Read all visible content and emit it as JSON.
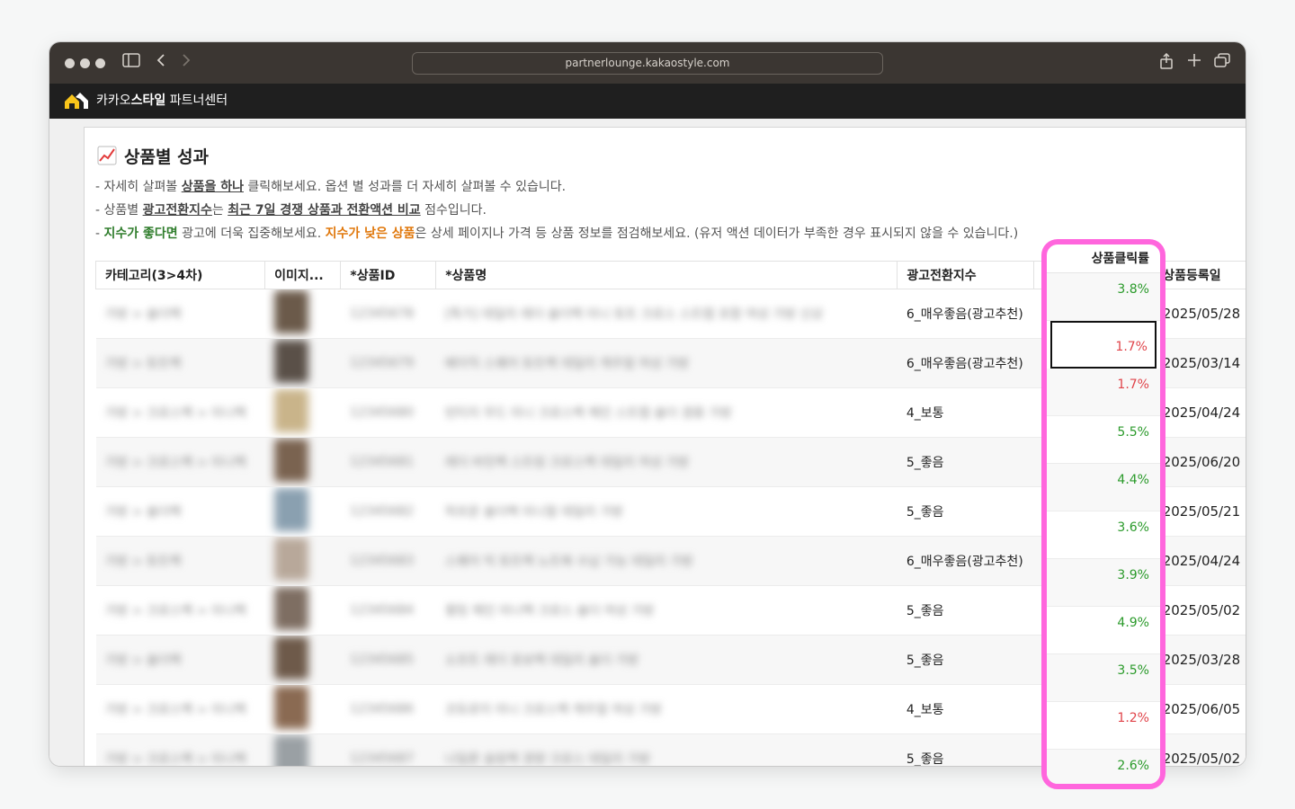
{
  "browser": {
    "url": "partnerlounge.kakaostyle.com",
    "icons": [
      "sidebar-icon",
      "back-icon",
      "forward-icon",
      "share-icon",
      "new-tab-icon",
      "tabs-icon"
    ]
  },
  "app": {
    "name_prefix": "카카오",
    "name_bold": "스타일",
    "name_suffix": " 파트너센터"
  },
  "section": {
    "title": "상품별 성과",
    "line1": {
      "a": "- 자세히 살펴볼 ",
      "b": "상품을 하나",
      "c": " 클릭해보세요. 옵션 별 성과를 더 자세히 살펴볼 수 있습니다."
    },
    "line2": {
      "a": "- 상품별 ",
      "b": "광고전환지수",
      "c": "는 ",
      "d": "최근 7일 경쟁 상품과 전환액션 비교",
      "e": " 점수입니다."
    },
    "line3": {
      "a": "- ",
      "b": "지수가 좋다면",
      "c": " 광고에 더욱 집중해보세요. ",
      "d": "지수가 낮은 상품",
      "e": "은 상세 페이지나 가격 등 상품 정보를 점검해보세요. (유저 액션 데이터가 부족한 경우 표시되지 않을 수 있습니다.)"
    }
  },
  "table": {
    "headers": {
      "category": "카테고리(3>4차)",
      "image": "이미지...",
      "id": "*상품ID",
      "name": "*상품명",
      "index": "광고전환지수",
      "click": "상품클릭률",
      "date": "상품등록일"
    },
    "rows": [
      {
        "category": "가방 > 숄더백",
        "id": "12345678",
        "name": "[특가] 데일리 레더 숄더백 미니 토트 크로스 스트랩 포함 여성 가방 신상",
        "index": "6_매우좋음(광고추천)",
        "tone": "green",
        "click": "3.8%",
        "click_tone": "green",
        "date": "2025/05/28"
      },
      {
        "category": "가방 > 토트백",
        "id": "12345679",
        "name": "베이직 스퀘어 토트백 데일리 캐주얼 여성 가방",
        "index": "6_매우좋음(광고추천)",
        "tone": "green",
        "click": "1.7%",
        "click_tone": "red",
        "date": "2025/03/14"
      },
      {
        "category": "가방 > 크로스백 > 미니백",
        "id": "12345680",
        "name": "빈티지 무드 미니 크로스백 체인 스트랩 숄더 겸용 가방",
        "index": "4_보통",
        "tone": "orange",
        "click": "1.7%",
        "click_tone": "red",
        "date": "2025/04/24"
      },
      {
        "category": "가방 > 크로스백 > 미니백",
        "id": "12345681",
        "name": "레더 버킷백 스트링 크로스백 데일리 여성 가방",
        "index": "5_좋음",
        "tone": "green",
        "click": "5.5%",
        "click_tone": "green",
        "date": "2025/06/20"
      },
      {
        "category": "가방 > 숄더백",
        "id": "12345682",
        "name": "하프문 숄더백 미니멀 데일리 가방",
        "index": "5_좋음",
        "tone": "green",
        "click": "4.4%",
        "click_tone": "green",
        "date": "2025/05/21"
      },
      {
        "category": "가방 > 토트백",
        "id": "12345683",
        "name": "스퀘어 빅 토트백 노트북 수납 가능 데일리 가방",
        "index": "6_매우좋음(광고추천)",
        "tone": "green",
        "click": "3.6%",
        "click_tone": "green",
        "date": "2025/04/24"
      },
      {
        "category": "가방 > 크로스백 > 미니백",
        "id": "12345684",
        "name": "퀼팅 체인 미니백 크로스 숄더 여성 가방",
        "index": "5_좋음",
        "tone": "green",
        "click": "3.9%",
        "click_tone": "green",
        "date": "2025/05/02"
      },
      {
        "category": "가방 > 숄더백",
        "id": "12345685",
        "name": "소프트 레더 호보백 데일리 숄더 가방",
        "index": "5_좋음",
        "tone": "green",
        "click": "4.9%",
        "click_tone": "green",
        "date": "2025/03/28"
      },
      {
        "category": "가방 > 크로스백 > 미니백",
        "id": "12345686",
        "name": "코듀로이 미니 크로스백 캐주얼 여성 가방",
        "index": "4_보통",
        "tone": "orange",
        "click": "3.5%",
        "click_tone": "green",
        "date": "2025/06/05"
      },
      {
        "category": "가방 > 크로스백 > 미니백",
        "id": "12345687",
        "name": "나일론 슬링백 경량 크로스 데일리 가방",
        "index": "5_좋음",
        "tone": "green",
        "click": "1.2%",
        "click_tone": "red",
        "date": "2025/05/02"
      }
    ],
    "click_extra": {
      "click": "2.6%",
      "click_tone": "green"
    }
  },
  "colors": {
    "highlight": "#ff66dd",
    "good": "#1a9a1a",
    "normal": "#ee8a3a",
    "low": "#e0444a"
  }
}
